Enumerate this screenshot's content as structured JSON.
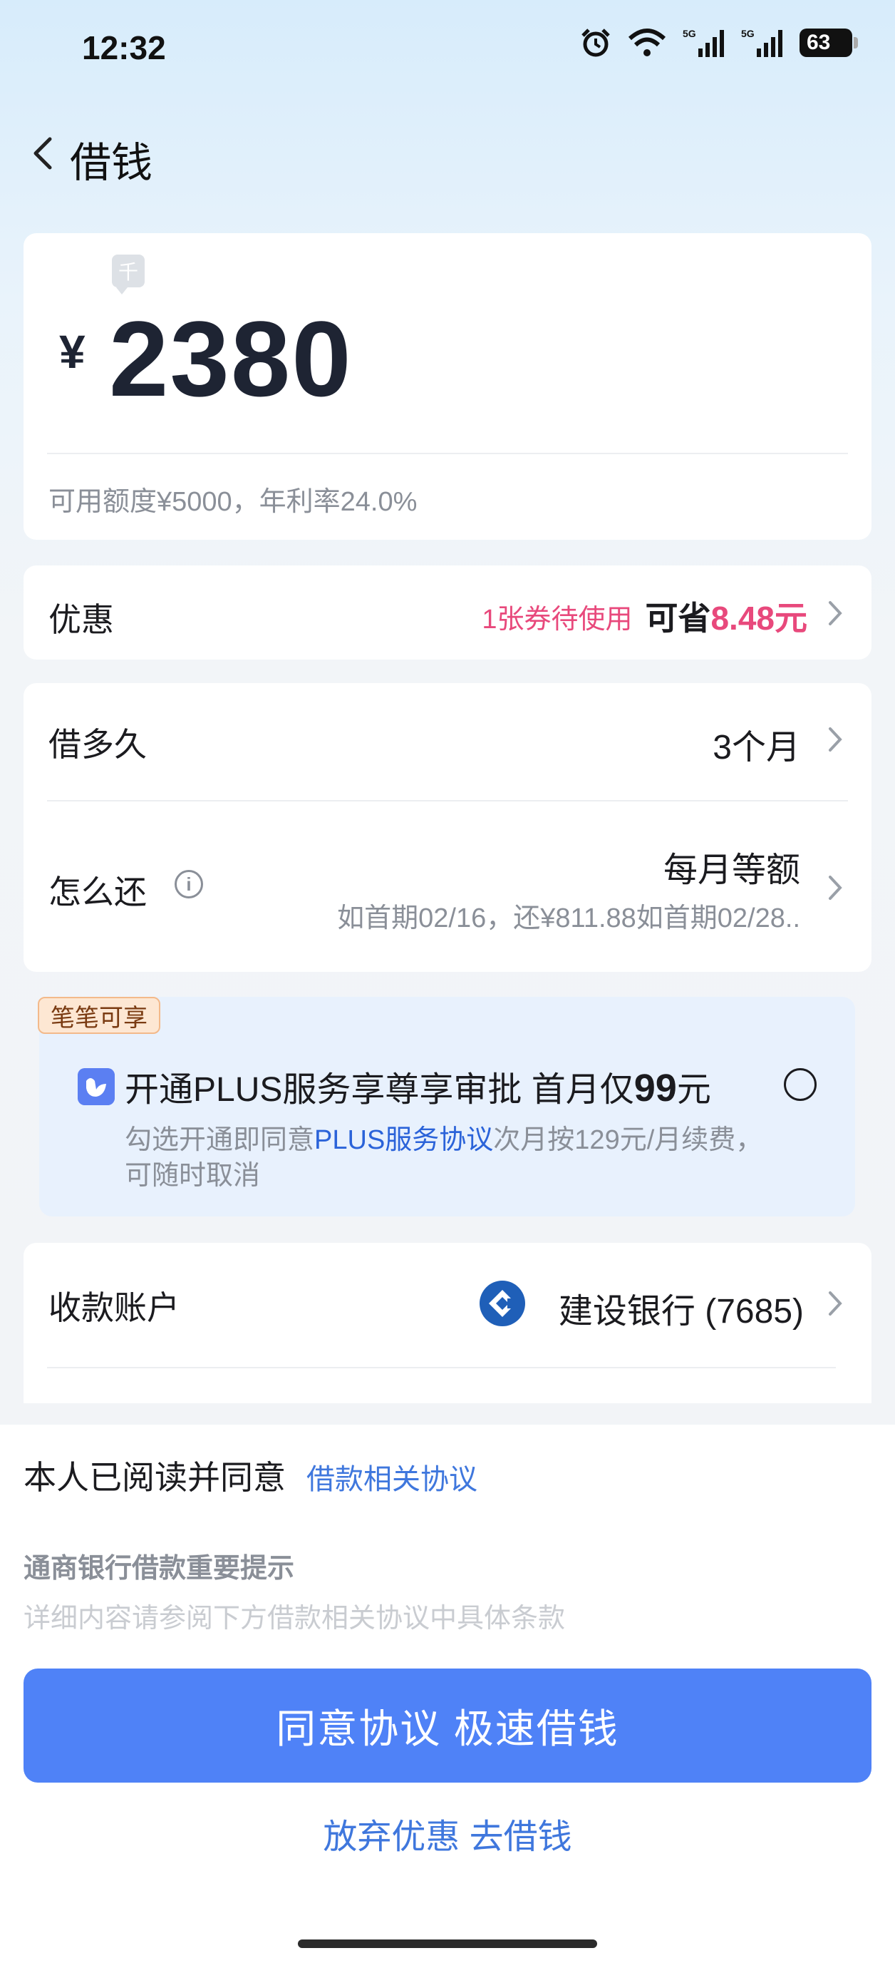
{
  "status_bar": {
    "time": "12:32",
    "battery": "63"
  },
  "nav": {
    "title": "借钱"
  },
  "amount": {
    "unit_tag": "千",
    "currency": "¥",
    "value": "2380",
    "quota_text": "可用额度¥5000，年利率24.0%"
  },
  "discount": {
    "label": "优惠",
    "coupon_text": "1张券待使用",
    "save_prefix": "可省",
    "save_amount": "8.48元"
  },
  "term": {
    "label": "借多久",
    "value": "3个月"
  },
  "repay": {
    "label": "怎么还",
    "info_symbol": "i",
    "value": "每月等额",
    "detail": "如首期02/16，还¥811.88如首期02/28.."
  },
  "plus": {
    "tag": "笔笔可享",
    "title_prefix": "开通PLUS服务享尊享审批  首月仅",
    "price": "99",
    "price_unit": "元",
    "desc_prefix": "勾选开通即同意",
    "desc_link": "PLUS服务协议",
    "desc_suffix": "次月按129元/月续费，可随时取消"
  },
  "account": {
    "label": "收款账户",
    "bank": "建设银行 (7685)"
  },
  "bottom": {
    "agree_text": "本人已阅读并同意",
    "agree_link": "借款相关协议",
    "notice_title": "通商银行借款重要提示",
    "notice_text": "详细内容请参阅下方借款相关协议中具体条款",
    "cta": "同意协议 极速借钱",
    "giveup": "放弃优惠 去借钱"
  },
  "colors": {
    "accent": "#4f82f7",
    "highlight": "#e8497c",
    "link": "#3f77dd"
  }
}
